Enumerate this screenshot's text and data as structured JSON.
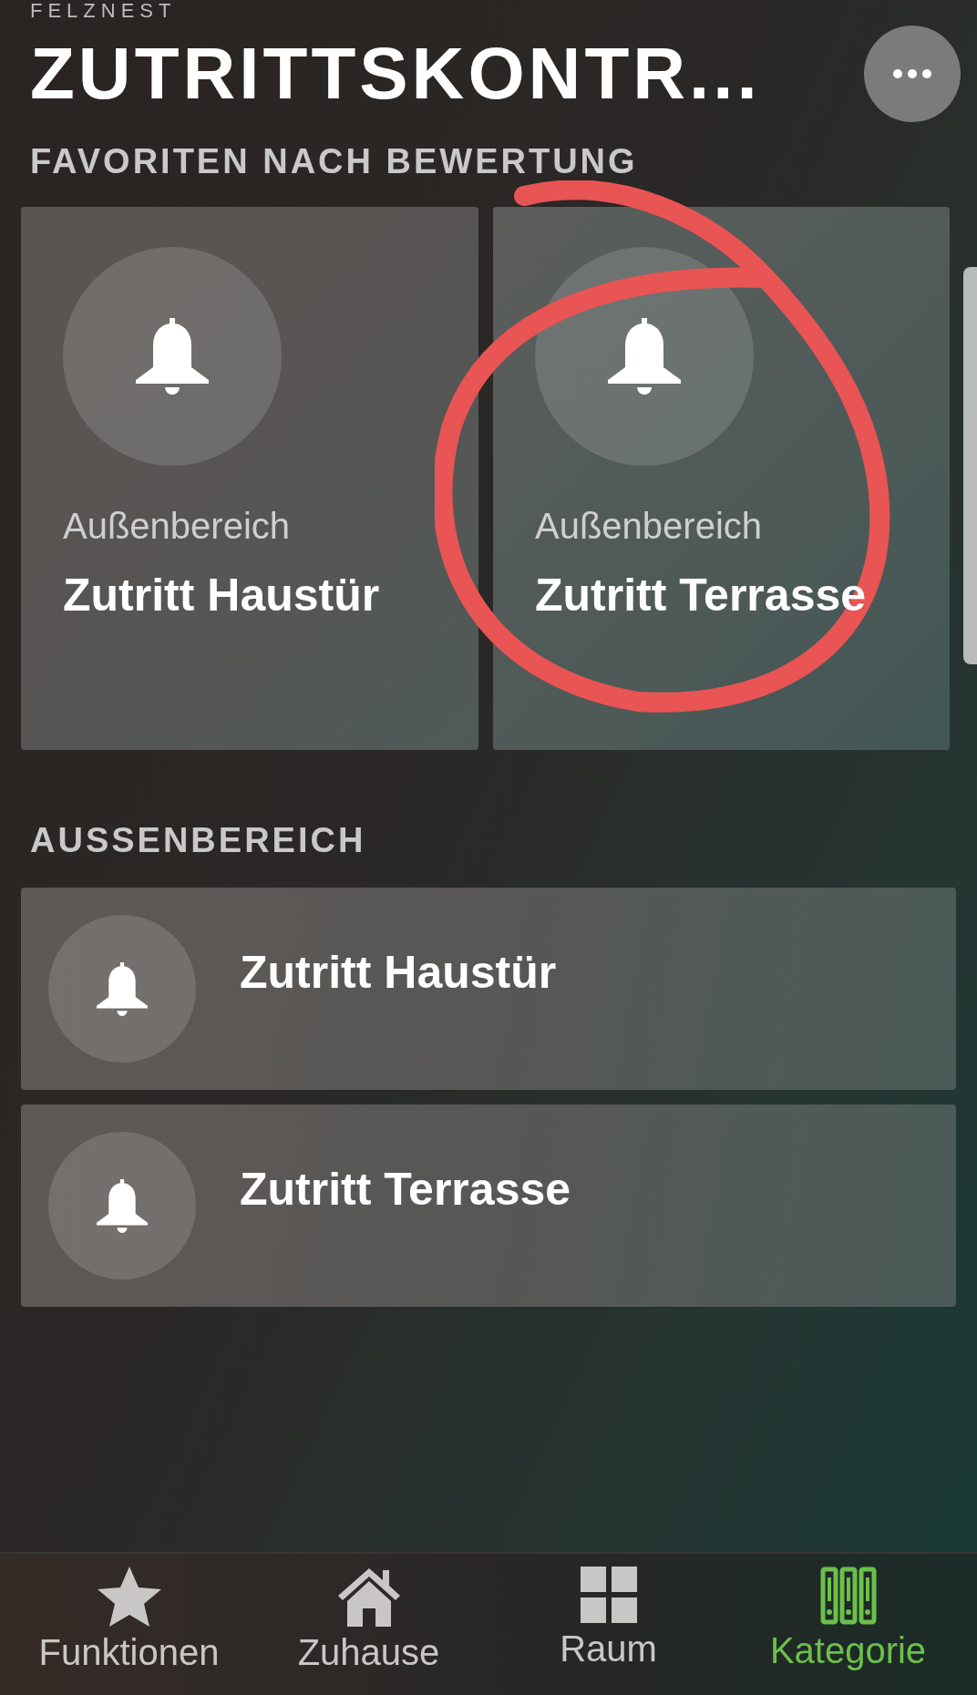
{
  "app_label": "FELZNEST",
  "title": "ZUTRITTSKONTR...",
  "favorites": {
    "heading": "FAVORITEN NACH BEWERTUNG",
    "cards": [
      {
        "room": "Außenbereich",
        "name": "Zutritt Haustür"
      },
      {
        "room": "Außenbereich",
        "name": "Zutritt Terrasse"
      }
    ]
  },
  "room_section": {
    "heading": "AUSSENBEREICH",
    "rows": [
      {
        "name": "Zutritt Haustür"
      },
      {
        "name": "Zutritt Terrasse"
      }
    ]
  },
  "nav": [
    {
      "label": "Funktionen",
      "selected": false
    },
    {
      "label": "Zuhause",
      "selected": false
    },
    {
      "label": "Raum",
      "selected": false
    },
    {
      "label": "Kategorie",
      "selected": true
    }
  ]
}
